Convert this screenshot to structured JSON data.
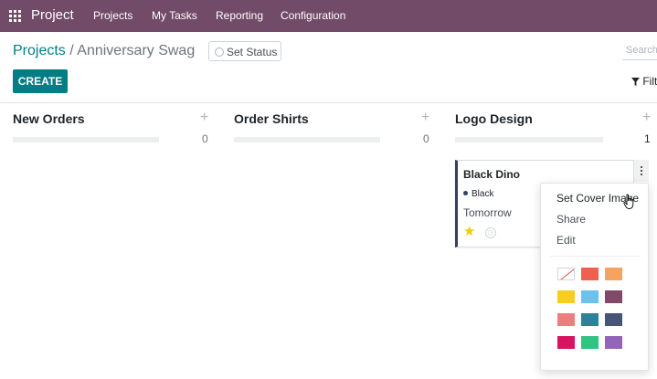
{
  "navbar": {
    "app_name": "Project",
    "menu_items": [
      "Projects",
      "My Tasks",
      "Reporting",
      "Configuration"
    ],
    "background_color": "#714b67"
  },
  "control_panel": {
    "breadcrumb_parent": "Projects",
    "breadcrumb_separator": "/",
    "breadcrumb_current": "Anniversary Swag",
    "set_status_label": "Set Status",
    "create_label": "CREATE",
    "search_placeholder": "Search...",
    "filters_label": "Filters",
    "primary_color": "#017e84"
  },
  "columns": [
    {
      "title": "New Orders",
      "add_icon": "+",
      "count": "0"
    },
    {
      "title": "Order Shirts",
      "add_icon": "+",
      "count": "0"
    },
    {
      "title": "Logo Design",
      "add_icon": "+",
      "count": "1"
    }
  ],
  "card": {
    "title": "Black Dino",
    "tag": "Black",
    "tag_color": "#35405d",
    "deadline": "Tomorrow",
    "starred": true,
    "star_icon": "star-icon",
    "activity_icon": "clock-icon"
  },
  "dropdown": {
    "items": [
      "Set Cover Image",
      "Share",
      "Edit"
    ],
    "colors": [
      "#ffffff",
      "#f06050",
      "#f4a460",
      "#f7cd1f",
      "#6cc1ed",
      "#814968",
      "#eb7e7f",
      "#2c8397",
      "#475577",
      "#d6145f",
      "#30c381",
      "#9365b8"
    ]
  }
}
